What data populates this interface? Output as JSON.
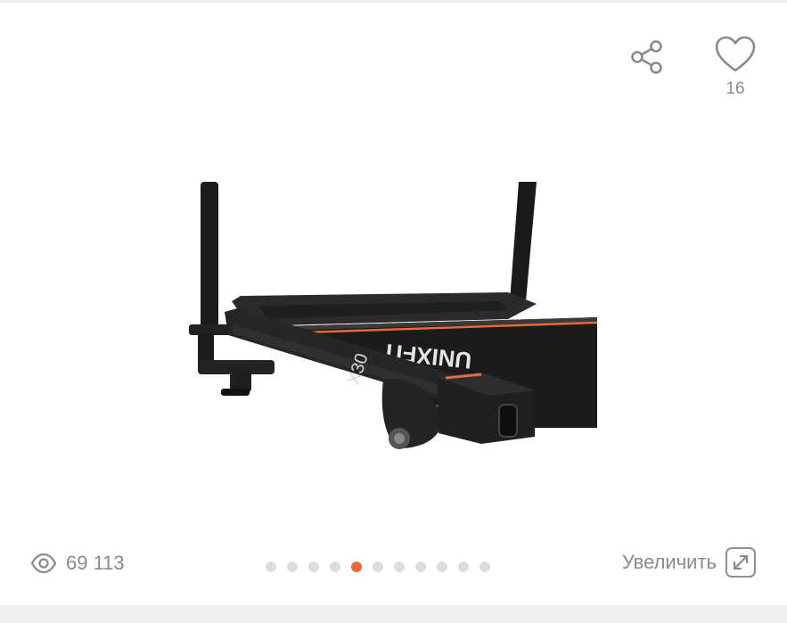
{
  "actions": {
    "favorites_count": "16"
  },
  "gallery": {
    "slide_count": 11,
    "active_slide": 5,
    "brand_text": "UNIXFIT",
    "model_text": "X30"
  },
  "footer": {
    "views": "69 113",
    "zoom_label": "Увеличить"
  },
  "colors": {
    "accent": "#e86a3a",
    "icon_gray": "#8a8a8a",
    "dot_gray": "#dcdcdc"
  }
}
